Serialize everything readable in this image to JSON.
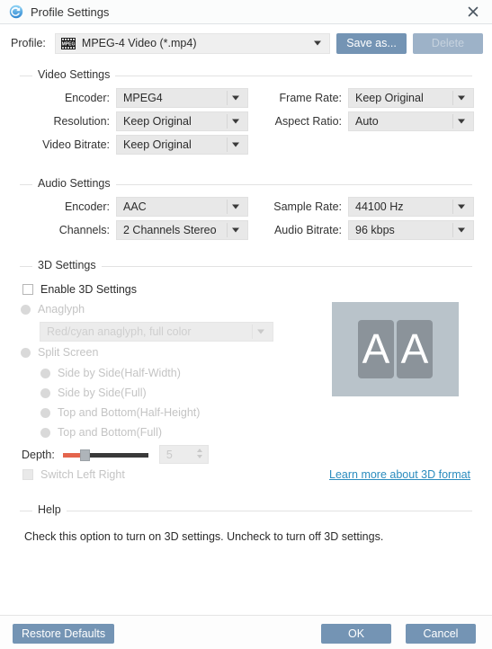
{
  "window": {
    "title": "Profile Settings",
    "app_icon": "convert-circular-arrow-icon",
    "close_icon": "close-icon",
    "accent_blue": "#7494b4",
    "link_color": "#2b8cbe"
  },
  "profile": {
    "label": "Profile:",
    "icon": "mpeg-film-icon",
    "value": "MPEG-4 Video (*.mp4)",
    "save_as_label": "Save as...",
    "delete_label": "Delete",
    "delete_disabled": true
  },
  "video_settings": {
    "title": "Video Settings",
    "fields": [
      {
        "label": "Encoder:",
        "value": "MPEG4"
      },
      {
        "label": "Resolution:",
        "value": "Keep Original"
      },
      {
        "label": "Video Bitrate:",
        "value": "Keep Original"
      },
      {
        "label": "Frame Rate:",
        "value": "Keep Original"
      },
      {
        "label": "Aspect Ratio:",
        "value": "Auto"
      }
    ]
  },
  "audio_settings": {
    "title": "Audio Settings",
    "fields": [
      {
        "label": "Encoder:",
        "value": "AAC"
      },
      {
        "label": "Channels:",
        "value": "2 Channels Stereo"
      },
      {
        "label": "Sample Rate:",
        "value": "44100 Hz"
      },
      {
        "label": "Audio Bitrate:",
        "value": "96 kbps"
      }
    ]
  },
  "three_d_settings": {
    "title": "3D Settings",
    "enable_label": "Enable 3D Settings",
    "enable_checked": false,
    "anaglyph_label": "Anaglyph",
    "anaglyph_value": "Red/cyan anaglyph, full color",
    "split_screen_label": "Split Screen",
    "split_options": [
      "Side by Side(Half-Width)",
      "Side by Side(Full)",
      "Top and Bottom(Half-Height)",
      "Top and Bottom(Full)"
    ],
    "depth_label": "Depth:",
    "depth_value": "5",
    "switch_left_right_label": "Switch Left Right",
    "learn_more_label": "Learn more about 3D format",
    "preview_letter_left": "A",
    "preview_letter_right": "A"
  },
  "help": {
    "title": "Help",
    "text": "Check this option to turn on 3D settings. Uncheck to turn off 3D settings."
  },
  "footer": {
    "restore_label": "Restore Defaults",
    "ok_label": "OK",
    "cancel_label": "Cancel"
  }
}
